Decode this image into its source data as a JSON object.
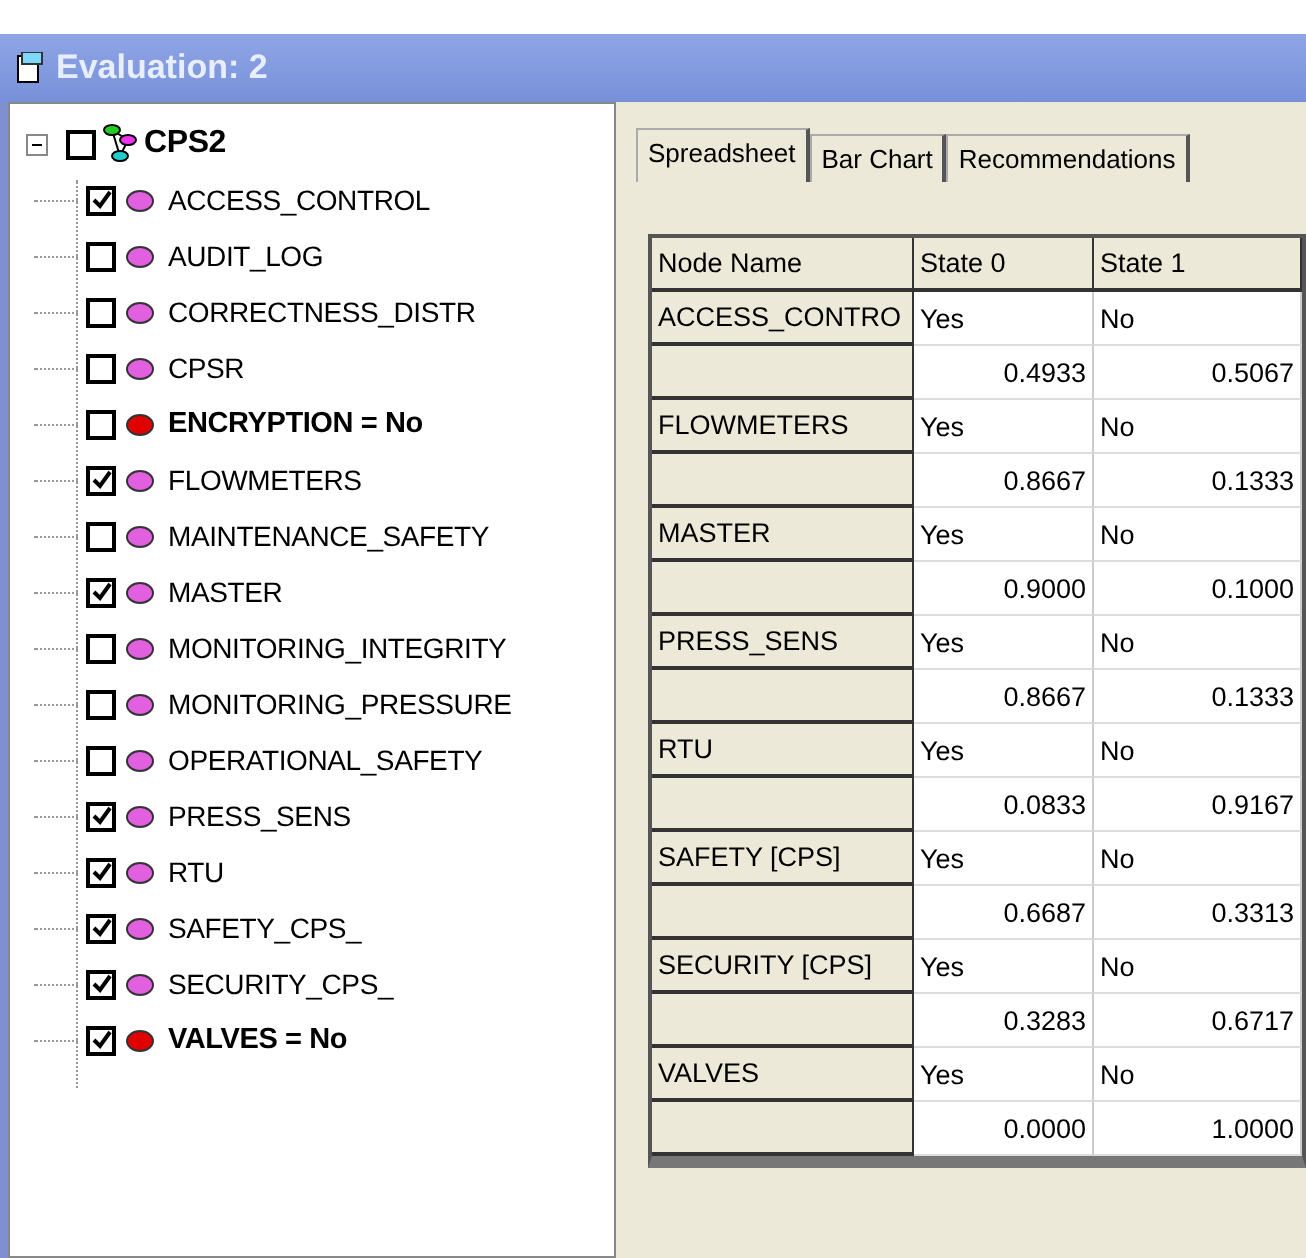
{
  "window": {
    "title": "Evaluation: 2"
  },
  "tree": {
    "label": "CPS2",
    "expanded": true,
    "checked": false,
    "children": [
      {
        "label": "ACCESS_CONTROL",
        "checked": true,
        "observed": false,
        "color": "#e060e0"
      },
      {
        "label": "AUDIT_LOG",
        "checked": false,
        "observed": false,
        "color": "#e060e0"
      },
      {
        "label": "CORRECTNESS_DISTR",
        "checked": false,
        "observed": false,
        "color": "#e060e0"
      },
      {
        "label": "CPSR",
        "checked": false,
        "observed": false,
        "color": "#e060e0"
      },
      {
        "label": "ENCRYPTION = No",
        "checked": false,
        "observed": true,
        "color": "#e00000"
      },
      {
        "label": "FLOWMETERS",
        "checked": true,
        "observed": false,
        "color": "#e060e0"
      },
      {
        "label": "MAINTENANCE_SAFETY",
        "checked": false,
        "observed": false,
        "color": "#e060e0"
      },
      {
        "label": "MASTER",
        "checked": true,
        "observed": false,
        "color": "#e060e0"
      },
      {
        "label": "MONITORING_INTEGRITY",
        "checked": false,
        "observed": false,
        "color": "#e060e0"
      },
      {
        "label": "MONITORING_PRESSURE",
        "checked": false,
        "observed": false,
        "color": "#e060e0"
      },
      {
        "label": "OPERATIONAL_SAFETY",
        "checked": false,
        "observed": false,
        "color": "#e060e0"
      },
      {
        "label": "PRESS_SENS",
        "checked": true,
        "observed": false,
        "color": "#e060e0"
      },
      {
        "label": "RTU",
        "checked": true,
        "observed": false,
        "color": "#e060e0"
      },
      {
        "label": "SAFETY_CPS_",
        "checked": true,
        "observed": false,
        "color": "#e060e0"
      },
      {
        "label": "SECURITY_CPS_",
        "checked": true,
        "observed": false,
        "color": "#e060e0"
      },
      {
        "label": "VALVES = No",
        "checked": true,
        "observed": true,
        "color": "#e00000"
      }
    ]
  },
  "tabs": [
    {
      "label": "Spreadsheet",
      "selected": true
    },
    {
      "label": "Bar Chart",
      "selected": false
    },
    {
      "label": "Recommendations",
      "selected": false
    }
  ],
  "table": {
    "columns": [
      "Node Name",
      "State 0",
      "State 1"
    ],
    "rows": [
      {
        "name": "ACCESS_CONTRO",
        "states": [
          "Yes",
          "No"
        ],
        "probs": [
          "0.4933",
          "0.5067"
        ]
      },
      {
        "name": "FLOWMETERS",
        "states": [
          "Yes",
          "No"
        ],
        "probs": [
          "0.8667",
          "0.1333"
        ]
      },
      {
        "name": "MASTER",
        "states": [
          "Yes",
          "No"
        ],
        "probs": [
          "0.9000",
          "0.1000"
        ]
      },
      {
        "name": "PRESS_SENS",
        "states": [
          "Yes",
          "No"
        ],
        "probs": [
          "0.8667",
          "0.1333"
        ]
      },
      {
        "name": "RTU",
        "states": [
          "Yes",
          "No"
        ],
        "probs": [
          "0.0833",
          "0.9167"
        ]
      },
      {
        "name": "SAFETY [CPS]",
        "states": [
          "Yes",
          "No"
        ],
        "probs": [
          "0.6687",
          "0.3313"
        ]
      },
      {
        "name": "SECURITY [CPS]",
        "states": [
          "Yes",
          "No"
        ],
        "probs": [
          "0.3283",
          "0.6717"
        ]
      },
      {
        "name": "VALVES",
        "states": [
          "Yes",
          "No"
        ],
        "probs": [
          "0.0000",
          "1.0000"
        ]
      }
    ]
  }
}
